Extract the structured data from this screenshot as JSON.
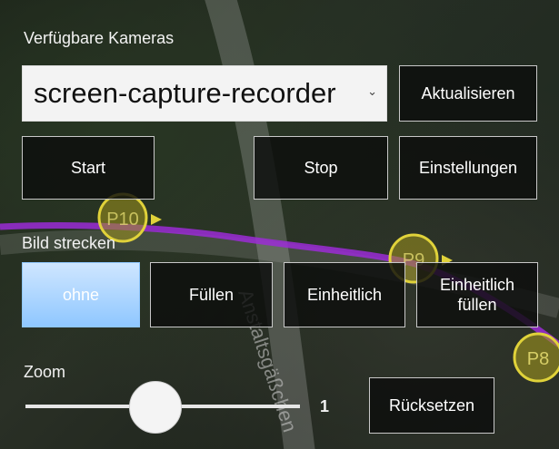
{
  "map": {
    "street_label": "Anstaltsgäßchen",
    "markers": [
      "P10",
      "P9",
      "P8"
    ],
    "colors": {
      "route": "#9b2bd6",
      "marker": "#e0d23a"
    }
  },
  "cameras": {
    "label": "Verfügbare Kameras",
    "selected": "screen-capture-recorder",
    "refresh_label": "Aktualisieren"
  },
  "controls": {
    "start_label": "Start",
    "stop_label": "Stop",
    "settings_label": "Einstellungen"
  },
  "stretch": {
    "label": "Bild strecken",
    "options": [
      "ohne",
      "Füllen",
      "Einheitlich",
      "Einheitlich füllen"
    ],
    "selected": "ohne"
  },
  "zoom": {
    "label": "Zoom",
    "value": "1",
    "reset_label": "Rücksetzen"
  },
  "colors": {
    "selected_button": "#8fc7ff",
    "border": "#c8c8c8"
  }
}
